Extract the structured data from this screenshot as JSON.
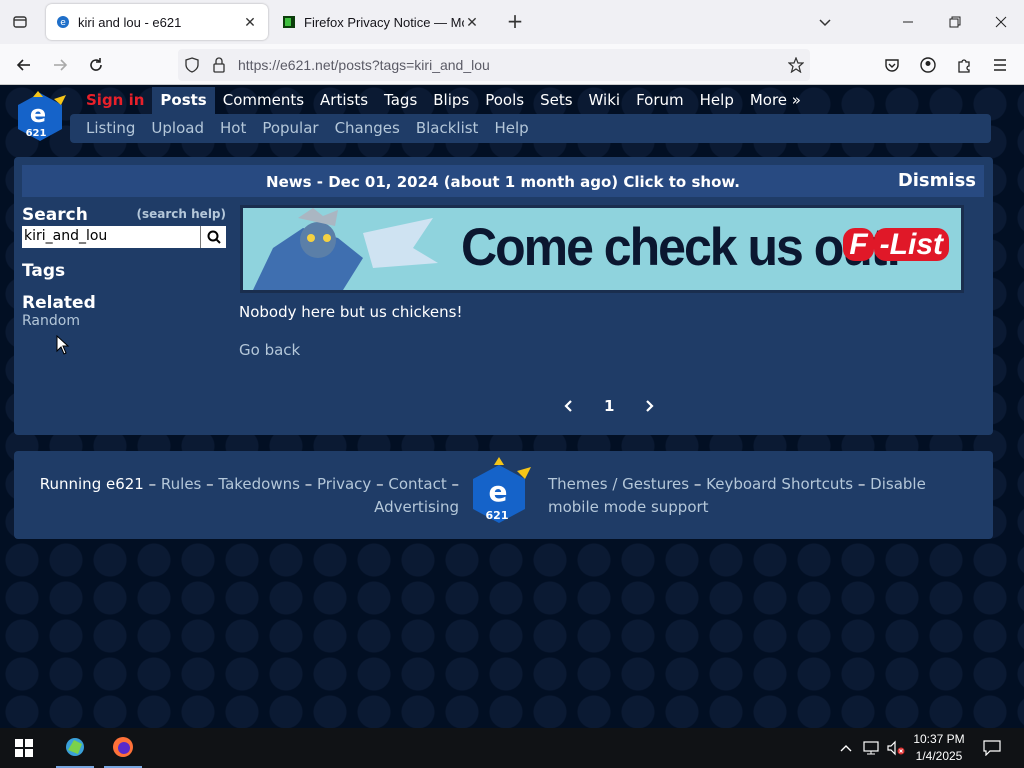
{
  "browser": {
    "tabs": [
      {
        "title": "kiri and lou - e621",
        "active": true
      },
      {
        "title": "Firefox Privacy Notice — Mozill",
        "active": false
      }
    ],
    "url_main": "https://e621.net",
    "url_path": "/posts?tags=kiri_and_lou"
  },
  "site": {
    "main_menu": [
      "Sign in",
      "Posts",
      "Comments",
      "Artists",
      "Tags",
      "Blips",
      "Pools",
      "Sets",
      "Wiki",
      "Forum",
      "Help",
      "More »"
    ],
    "sub_menu": [
      "Listing",
      "Upload",
      "Hot",
      "Popular",
      "Changes",
      "Blacklist",
      "Help"
    ],
    "news": {
      "text": "News - Dec 01, 2024 (about 1 month ago) Click to show.",
      "dismiss": "Dismiss"
    },
    "sidebar": {
      "search_title": "Search",
      "search_help": "(search help)",
      "search_value": "kiri_and_lou",
      "tags_title": "Tags",
      "related_title": "Related",
      "random": "Random"
    },
    "banner": {
      "slogan": "Come check us out!",
      "brand_letter": "F",
      "brand": "-List"
    },
    "empty_message": "Nobody here but us chickens!",
    "go_back": "Go back",
    "pager": {
      "prev": "‹",
      "current": "1",
      "next": "›"
    },
    "footer": {
      "running": "Running e621",
      "sep": " – ",
      "links_left": [
        "Rules",
        "Takedowns",
        "Privacy",
        "Contact",
        "Advertising"
      ],
      "links_right": [
        "Themes / Gestures",
        "Keyboard Shortcuts",
        "Disable mobile mode support"
      ]
    },
    "logo_text": "e",
    "logo_sub": "621"
  },
  "taskbar": {
    "time": "10:37 PM",
    "date": "1/4/2025"
  },
  "colors": {
    "accent_red": "#e8202a",
    "nav_blue": "#1f3c67",
    "link": "#b4c7d9"
  }
}
